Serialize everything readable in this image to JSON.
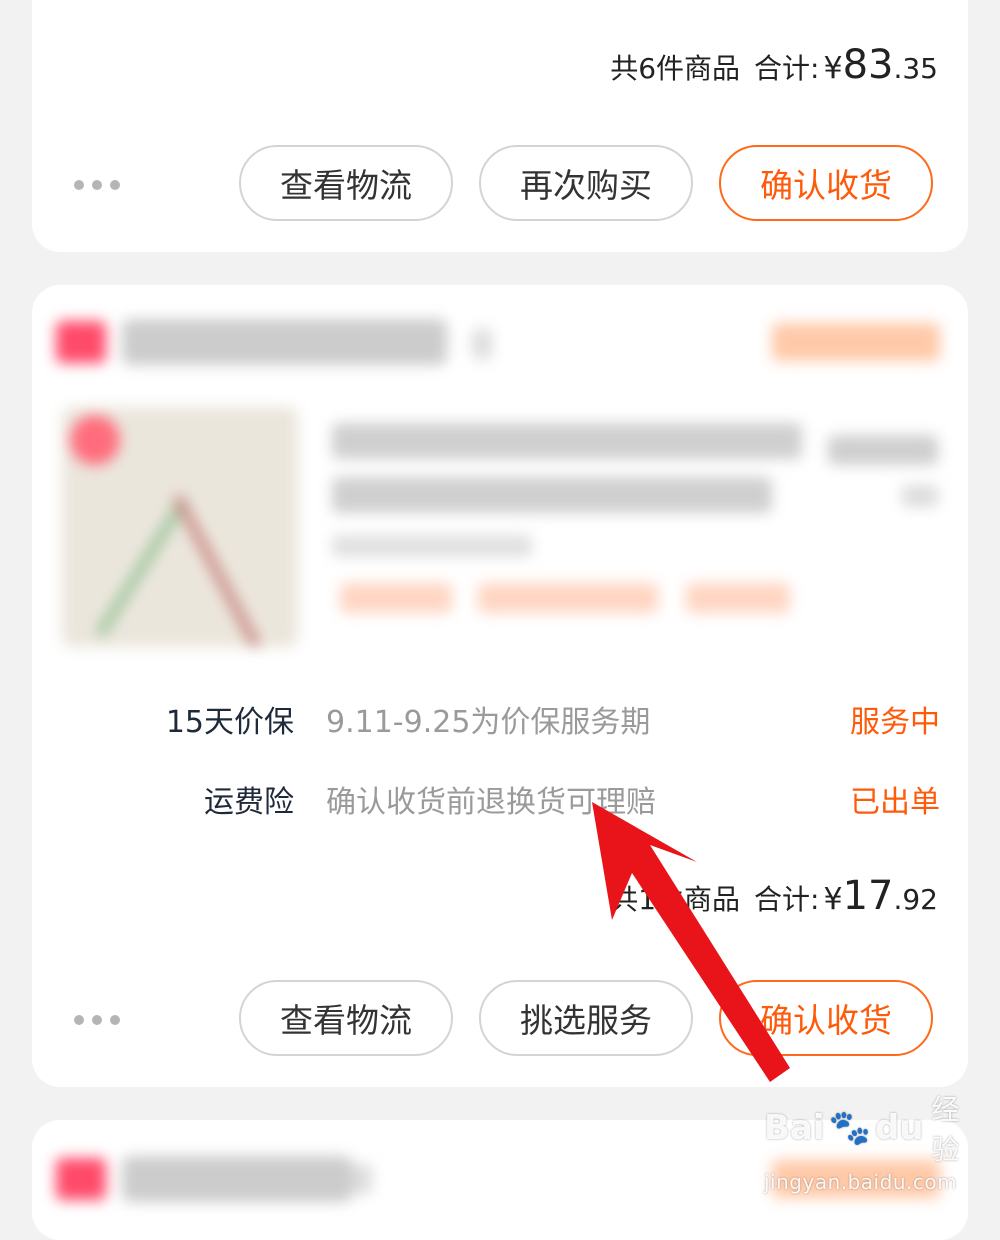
{
  "orders": [
    {
      "total": {
        "count_label": "共6件商品",
        "sum_label": "合计:",
        "currency": "¥",
        "integer": "83",
        "decimal": ".35"
      },
      "buttons": {
        "logistics": "查看物流",
        "second": "再次购买",
        "confirm": "确认收货"
      }
    },
    {
      "services": [
        {
          "name": "15天价保",
          "desc": "9.11-9.25为价保服务期",
          "status": "服务中"
        },
        {
          "name": "运费险",
          "desc": "确认收货前退换货可理赔",
          "status": "已出单"
        }
      ],
      "total": {
        "count_label": "共1件商品",
        "sum_label": "合计:",
        "currency": "¥",
        "integer": "17",
        "decimal": ".92"
      },
      "buttons": {
        "logistics": "查看物流",
        "second": "挑选服务",
        "confirm": "确认收货"
      }
    }
  ],
  "colors": {
    "accent": "#ff5a0a",
    "annotation_arrow": "#e8141a",
    "background": "#f2f2f2"
  },
  "watermark": {
    "brand_left": "Bai",
    "brand_right": "du",
    "product": "经验",
    "url": "jingyan.baidu.com"
  }
}
